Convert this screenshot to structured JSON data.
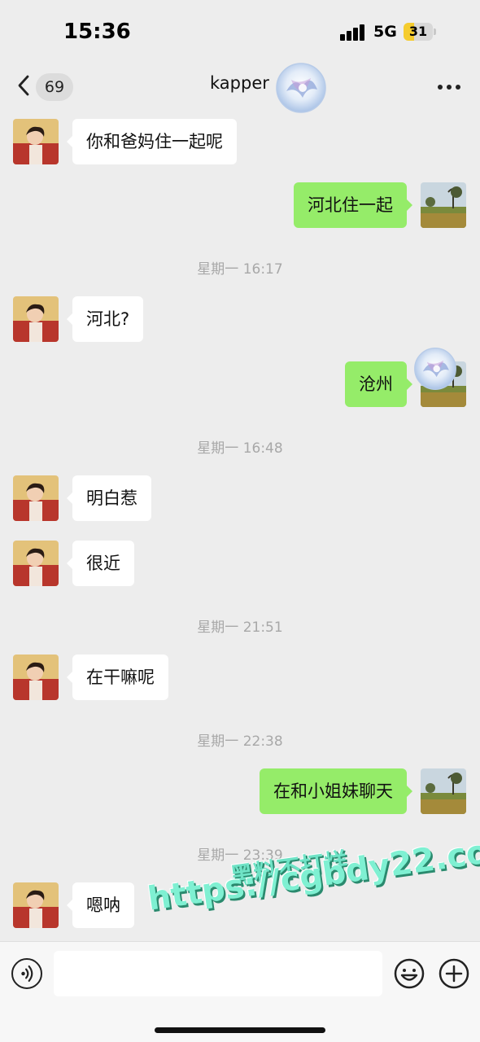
{
  "status_bar": {
    "time": "15:36",
    "network": "5G",
    "battery": "31",
    "battery_level_percent": 31,
    "battery_color": "#f5cc2e",
    "signal_icon": "signal-bars-icon"
  },
  "nav": {
    "back_icon": "chevron-left-icon",
    "unread_count": "69",
    "title": "kapper",
    "more_icon": "more-dots-icon"
  },
  "messages": [
    {
      "side": "in",
      "text": "你和爸妈住一起呢"
    },
    {
      "side": "out",
      "text": "河北住一起"
    },
    {
      "timestamp": "星期一 16:17"
    },
    {
      "side": "in",
      "text": "河北?"
    },
    {
      "side": "out",
      "text": "沧州"
    },
    {
      "timestamp": "星期一 16:48"
    },
    {
      "side": "in",
      "text": "明白惹"
    },
    {
      "side": "in",
      "text": "很近"
    },
    {
      "timestamp": "星期一 21:51"
    },
    {
      "side": "in",
      "text": "在干嘛呢"
    },
    {
      "timestamp": "星期一 22:38"
    },
    {
      "side": "out",
      "text": "在和小姐妹聊天"
    },
    {
      "timestamp": "星期一 23:39"
    },
    {
      "side": "in",
      "text": "嗯呐"
    }
  ],
  "watermark": {
    "line1": "黑料不打烊",
    "line2": "https://cgbdy22.com"
  },
  "input_bar": {
    "voice_icon": "voice-icon",
    "input_value": "",
    "emoji_icon": "emoji-icon",
    "plus_icon": "plus-icon"
  },
  "colors": {
    "background": "#ededed",
    "outgoing_bubble": "#95ec69",
    "incoming_bubble": "#ffffff"
  }
}
